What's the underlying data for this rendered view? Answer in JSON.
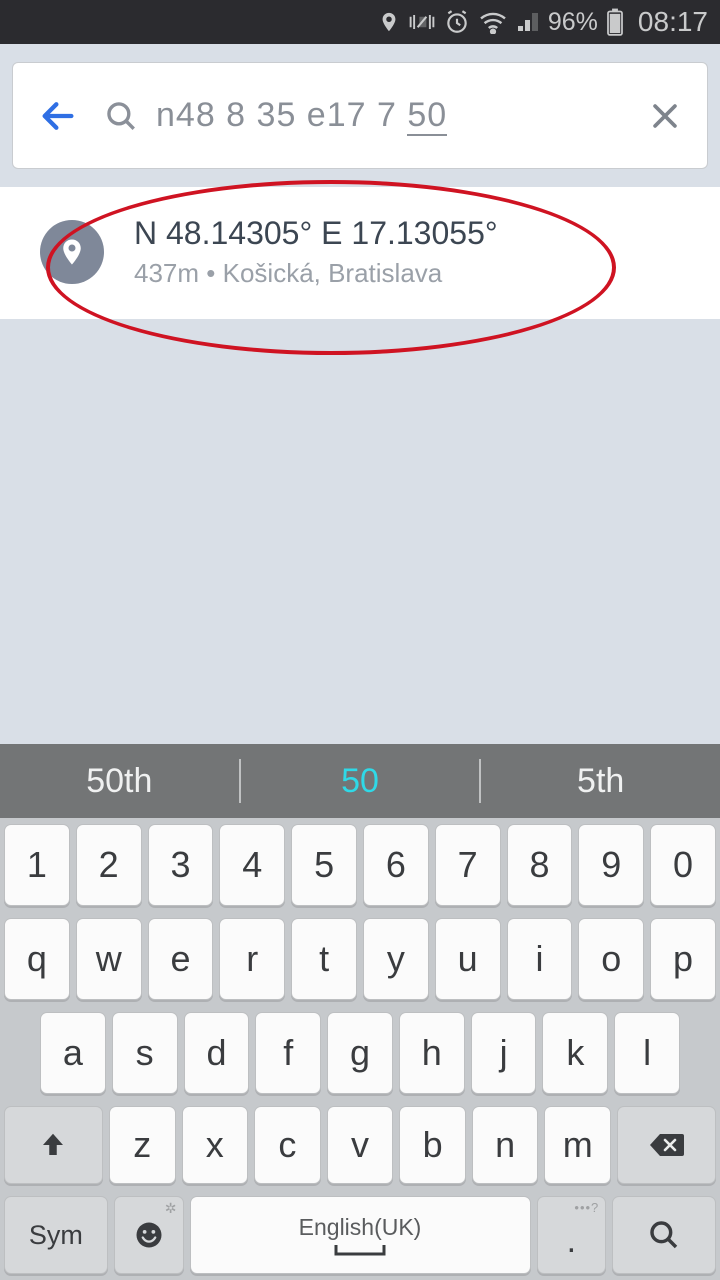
{
  "status": {
    "battery_pct": "96%",
    "time": "08:17"
  },
  "search": {
    "text_prefix": "n48 8 35 e17 7 ",
    "text_underlined": "50"
  },
  "result": {
    "title": "N 48.14305° E 17.13055°",
    "distance": "437m",
    "sep": " • ",
    "place": "Košická, Bratislava"
  },
  "suggestions": {
    "left": "50th",
    "mid": "50",
    "right": "5th"
  },
  "keyboard": {
    "row_num": [
      "1",
      "2",
      "3",
      "4",
      "5",
      "6",
      "7",
      "8",
      "9",
      "0"
    ],
    "row1": [
      "q",
      "w",
      "e",
      "r",
      "t",
      "y",
      "u",
      "i",
      "o",
      "p"
    ],
    "row2": [
      "a",
      "s",
      "d",
      "f",
      "g",
      "h",
      "j",
      "k",
      "l"
    ],
    "row3": [
      "z",
      "x",
      "c",
      "v",
      "b",
      "n",
      "m"
    ],
    "sym": "Sym",
    "lang": "English(UK)",
    "dot": "."
  }
}
